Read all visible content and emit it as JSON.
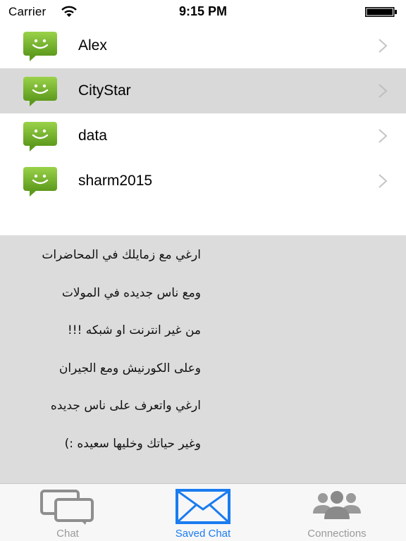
{
  "status_bar": {
    "carrier": "Carrier",
    "time": "9:15 PM",
    "wifi_icon": "wifi-icon",
    "battery_icon": "battery-full-icon"
  },
  "contacts": [
    {
      "name": "Alex",
      "selected": false,
      "icon": "chat-smiley-icon"
    },
    {
      "name": "CityStar",
      "selected": true,
      "icon": "chat-smiley-icon"
    },
    {
      "name": "data",
      "selected": false,
      "icon": "chat-smiley-icon"
    },
    {
      "name": "sharm2015",
      "selected": false,
      "icon": "chat-smiley-icon"
    }
  ],
  "message": {
    "lines": [
      "ارغي مع زمايلك في المحاضرات",
      "ومع ناس جديده في المولات",
      "من غير انترنت او شبكه !!!",
      "وعلى الكورنيش ومع الجيران",
      "ارغي واتعرف على ناس جديده",
      "وغير حياتك وخليها سعيده :)"
    ]
  },
  "tab_bar": {
    "tabs": [
      {
        "label": "Chat",
        "icon": "chat-bubbles-icon",
        "active": false
      },
      {
        "label": "Saved Chat",
        "icon": "envelope-icon",
        "active": true
      },
      {
        "label": "Connections",
        "icon": "people-icon",
        "active": false
      }
    ]
  },
  "colors": {
    "accent": "#1a7cf0",
    "chat_icon_green": "#7cbf2a",
    "selected_row": "#d9d9d9",
    "message_panel": "#dcdcdc",
    "inactive_tab": "#9a9a9a"
  }
}
